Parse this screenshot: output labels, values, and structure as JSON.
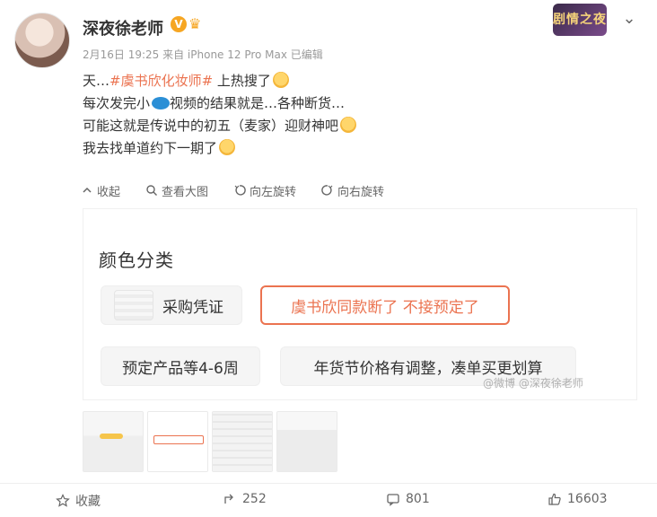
{
  "post": {
    "author": {
      "name": "深夜徐老师",
      "verified_mark": "V",
      "crown_mark": "♛"
    },
    "meta": "2月16日 19:25 来自 iPhone 12 Pro Max  已编辑",
    "badge_text": "剧情之夜",
    "text": {
      "line1_prefix": "天…",
      "line1_hashtag": "#虞书欣化妆师#",
      "line1_suffix": " 上热搜了",
      "line2": "每次发完小",
      "line2b": "视频的结果就是…各种断货…",
      "line3": "可能这就是传说中的初五（麦家）迎财神吧",
      "line4": "我去找单道约下一期了"
    },
    "actions": {
      "collect": "收起",
      "view_large": "查看大图",
      "rotate_left": "向左旋转",
      "rotate_right": "向右旋转"
    },
    "image_panel": {
      "title": "颜色分类",
      "chips": [
        {
          "label": "采购凭证",
          "selected": false,
          "has_thumb": true
        },
        {
          "label": "虞书欣同款断了 不接预定了",
          "selected": true,
          "has_thumb": false
        },
        {
          "label": "预定产品等4-6周",
          "selected": false,
          "has_thumb": false
        },
        {
          "label": "年货节价格有调整，凑单买更划算",
          "selected": false,
          "has_thumb": false
        }
      ],
      "watermark": "@微博  @深夜徐老师"
    },
    "thumbnails": [
      "image-1",
      "image-2",
      "image-3",
      "image-4"
    ],
    "bottom_bar": {
      "favorite": "收藏",
      "repost_count": "252",
      "comment_count": "801",
      "like_count": "16603"
    },
    "colors": {
      "accent": "#eb7350",
      "meta_gray": "#999999"
    }
  }
}
